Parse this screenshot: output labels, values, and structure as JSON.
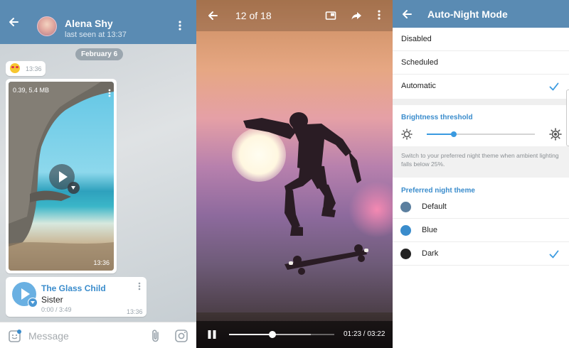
{
  "chat": {
    "contact_name": "Alena Shy",
    "status": "last seen at 13:37",
    "date_label": "February 6",
    "messages": {
      "emoji_time": "13:36",
      "video": {
        "meta": "0.39, 5.4 MB",
        "time": "13:36"
      },
      "audio": {
        "title": "The Glass Child",
        "artist": "Sister",
        "duration": "0:00 / 3:49",
        "time": "13:36"
      }
    },
    "input_placeholder": "Message"
  },
  "viewer": {
    "counter": "12 of 18",
    "time": "01:23 / 03:22",
    "progress": 0.41,
    "buffered": 0.78
  },
  "settings": {
    "title": "Auto-Night Mode",
    "modes": [
      {
        "label": "Disabled",
        "checked": false
      },
      {
        "label": "Scheduled",
        "checked": false
      },
      {
        "label": "Automatic",
        "checked": true
      }
    ],
    "brightness_title": "Brightness threshold",
    "brightness_value": 0.25,
    "info": "Switch to your preferred night theme when ambient lighting falls below 25%.",
    "theme_title": "Preferred night theme",
    "themes": [
      {
        "label": "Default",
        "color": "#5b7f9f",
        "checked": false
      },
      {
        "label": "Blue",
        "color": "#3a8ccc",
        "checked": false
      },
      {
        "label": "Dark",
        "color": "#222222",
        "checked": true
      }
    ]
  },
  "colors": {
    "header": "#5a8bb3",
    "accent": "#3a8ccc"
  }
}
